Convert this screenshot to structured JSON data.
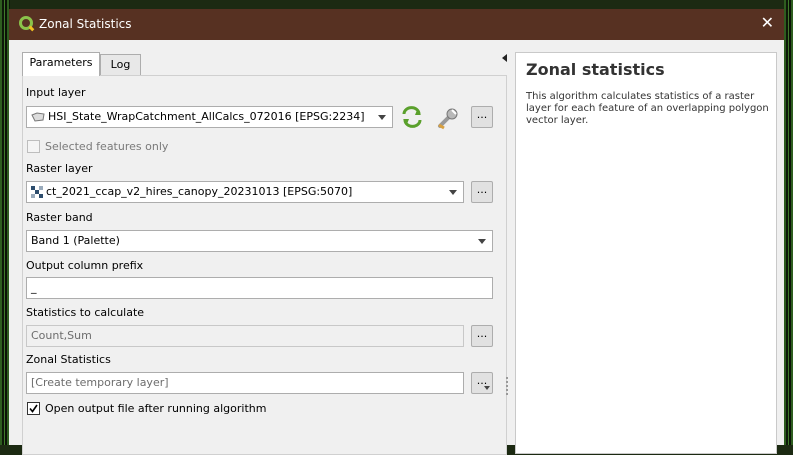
{
  "window": {
    "title": "Zonal Statistics"
  },
  "tabs": [
    {
      "label": "Parameters"
    },
    {
      "label": "Log"
    }
  ],
  "params": {
    "input_layer": {
      "label": "Input layer",
      "value": "HSI_State_WrapCatchment_AllCalcs_072016 [EPSG:2234]"
    },
    "selected_only": {
      "label": "Selected features only"
    },
    "raster_layer": {
      "label": "Raster layer",
      "value": "ct_2021_ccap_v2_hires_canopy_20231013 [EPSG:5070]"
    },
    "raster_band": {
      "label": "Raster band",
      "value": "Band 1 (Palette)"
    },
    "prefix": {
      "label": "Output column prefix",
      "value": "_"
    },
    "stats": {
      "label": "Statistics to calculate",
      "value": "Count,Sum"
    },
    "output": {
      "label": "Zonal Statistics",
      "placeholder": "[Create temporary layer]"
    },
    "open_after": {
      "label": "Open output file after running algorithm",
      "checked": true
    },
    "dots": "..."
  },
  "help": {
    "title": "Zonal statistics",
    "text": "This algorithm calculates statistics of a raster layer for each feature of an overlapping polygon vector layer."
  }
}
